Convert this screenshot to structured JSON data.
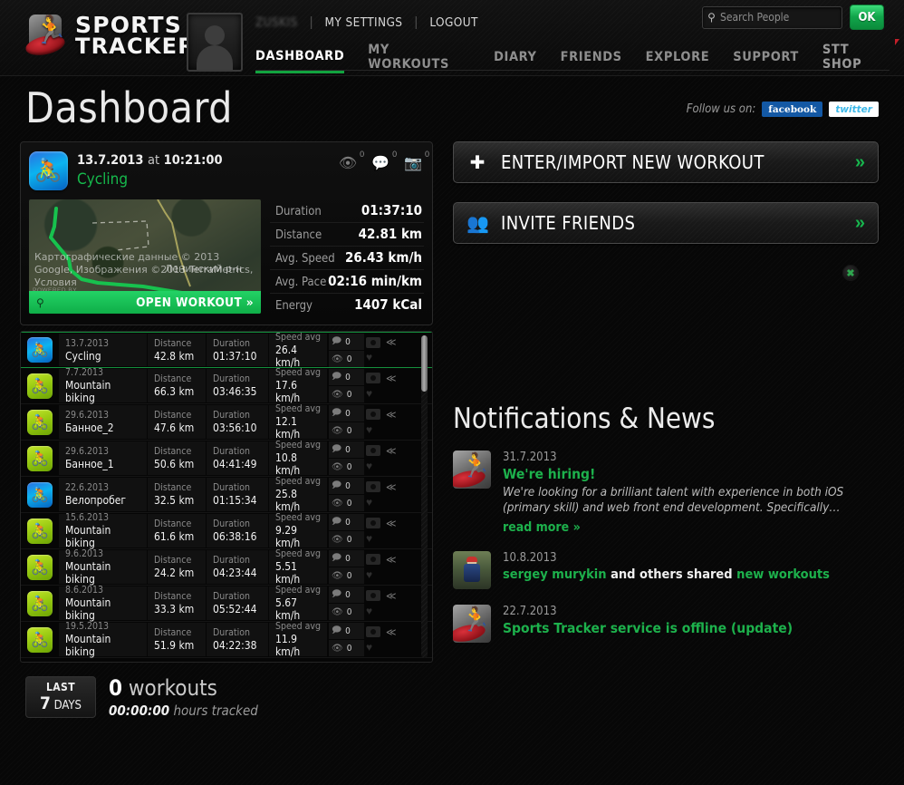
{
  "header": {
    "logo": {
      "line1": "SPORTS",
      "line2": "TRACKER",
      "icon": "runner-icon"
    },
    "user_links": {
      "username": "ZUSKIS",
      "my_settings": "MY SETTINGS",
      "logout": "LOGOUT"
    },
    "nav": [
      {
        "label": "DASHBOARD",
        "active": true
      },
      {
        "label": "MY WORKOUTS",
        "active": false
      },
      {
        "label": "DIARY",
        "active": false
      },
      {
        "label": "FRIENDS",
        "active": false
      },
      {
        "label": "EXPLORE",
        "active": false
      },
      {
        "label": "SUPPORT",
        "active": false
      }
    ],
    "shop": "STT SHOP",
    "search": {
      "placeholder": "Search People",
      "value": "",
      "button": "OK",
      "icon": "search-icon"
    }
  },
  "title": "Dashboard",
  "follow": {
    "label": "Follow us on:",
    "facebook": "facebook",
    "twitter": "twitter"
  },
  "featured_workout": {
    "date": "13.7.2013",
    "at": "at",
    "time": "10:21:00",
    "sport": "Cycling",
    "counters": {
      "views": "0",
      "comments": "0",
      "photos": "0"
    },
    "map": {
      "credit": "Картографические данные © 2013 Google, Изображения ©2013 TerraMetrics, Условия",
      "place": "Ленинский р-н",
      "powered": "POWERED BY",
      "watermark": "Google",
      "open_label": "OPEN WORKOUT »"
    },
    "facts": [
      {
        "key": "Duration",
        "value": "01:37:10"
      },
      {
        "key": "Distance",
        "value": "42.81 km"
      },
      {
        "key": "Avg. Speed",
        "value": "26.43 km/h"
      },
      {
        "key": "Avg. Pace",
        "value": "02:16 min/km"
      },
      {
        "key": "Energy",
        "value": "1407 kCal"
      }
    ]
  },
  "workout_list": {
    "labels": {
      "distance": "Distance",
      "duration": "Duration",
      "speed": "Speed avg"
    },
    "rows": [
      {
        "icon": "blue",
        "date": "13.7.2013",
        "name": "Cycling",
        "distance": "42.8 km",
        "duration": "01:37:10",
        "speed": "26.4 km/h",
        "comments": "0",
        "views": "0",
        "selected": true
      },
      {
        "icon": "green",
        "date": "7.7.2013",
        "name": "Mountain biking",
        "distance": "66.3 km",
        "duration": "03:46:35",
        "speed": "17.6 km/h",
        "comments": "0",
        "views": "0",
        "selected": false
      },
      {
        "icon": "green",
        "date": "29.6.2013",
        "name": "Банное_2",
        "distance": "47.6 km",
        "duration": "03:56:10",
        "speed": "12.1 km/h",
        "comments": "0",
        "views": "0",
        "selected": false
      },
      {
        "icon": "green",
        "date": "29.6.2013",
        "name": "Банное_1",
        "distance": "50.6 km",
        "duration": "04:41:49",
        "speed": "10.8 km/h",
        "comments": "0",
        "views": "0",
        "selected": false
      },
      {
        "icon": "blue",
        "date": "22.6.2013",
        "name": "Велопробег",
        "distance": "32.5 km",
        "duration": "01:15:34",
        "speed": "25.8 km/h",
        "comments": "0",
        "views": "0",
        "selected": false
      },
      {
        "icon": "green",
        "date": "15.6.2013",
        "name": "Mountain biking",
        "distance": "61.6 km",
        "duration": "06:38:16",
        "speed": "9.29 km/h",
        "comments": "0",
        "views": "0",
        "selected": false
      },
      {
        "icon": "green",
        "date": "9.6.2013",
        "name": "Mountain biking",
        "distance": "24.2 km",
        "duration": "04:23:44",
        "speed": "5.51 km/h",
        "comments": "0",
        "views": "0",
        "selected": false
      },
      {
        "icon": "green",
        "date": "8.6.2013",
        "name": "Mountain biking",
        "distance": "33.3 km",
        "duration": "05:52:44",
        "speed": "5.67 km/h",
        "comments": "0",
        "views": "0",
        "selected": false
      },
      {
        "icon": "green",
        "date": "19.5.2013",
        "name": "Mountain biking",
        "distance": "51.9 km",
        "duration": "04:22:38",
        "speed": "11.9 km/h",
        "comments": "0",
        "views": "0",
        "selected": false
      }
    ]
  },
  "last7": {
    "badge_top": "LAST",
    "badge_num": "7",
    "badge_unit": "DAYS",
    "count": "0",
    "count_label": "workouts",
    "hours": "00:00:00",
    "hours_label": "hours tracked"
  },
  "actions": [
    {
      "label": "ENTER/IMPORT NEW WORKOUT",
      "icon": "plus-icon",
      "chevron": "»"
    },
    {
      "label": "INVITE FRIENDS",
      "icon": "people-icon",
      "chevron": "»"
    }
  ],
  "ad_close": "✖",
  "news": {
    "heading": "Notifications & News",
    "items": [
      {
        "thumb": "logo",
        "date": "31.7.2013",
        "title": "We're hiring!",
        "text": "We're looking for a brilliant talent with experience in both iOS (primary skill) and web front end development. Specifically…",
        "read_more": "read more »"
      },
      {
        "thumb": "photo",
        "date": "10.8.2013",
        "share_user": "sergey murykin",
        "share_mid": " and others shared ",
        "share_obj": "new workouts"
      },
      {
        "thumb": "logo",
        "date": "22.7.2013",
        "title": "Sports Tracker service is offline (update)"
      }
    ]
  },
  "colors": {
    "accent_green": "#16b94c",
    "brand_red": "#c3202a",
    "facebook_blue": "#1358a4",
    "twitter_blue": "#3cb8e8"
  }
}
